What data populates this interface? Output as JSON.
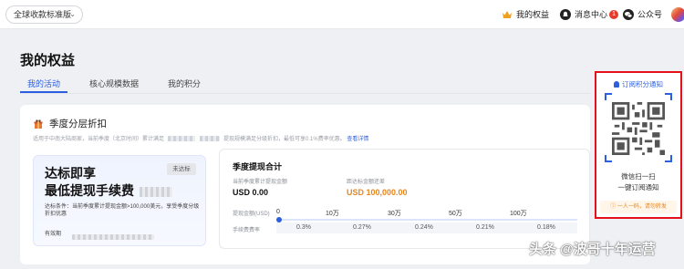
{
  "header": {
    "version_select": "全球收款标准版",
    "benefits": "我的权益",
    "messages": "消息中心",
    "message_count": "1",
    "official_account": "公众号"
  },
  "page": {
    "title": "我的权益",
    "tabs": [
      {
        "label": "我的活动",
        "active": true
      },
      {
        "label": "核心规模数据",
        "active": false
      },
      {
        "label": "我的积分",
        "active": false
      }
    ]
  },
  "activity": {
    "title": "季度分层折扣",
    "desc_start": "适用于中南大陆商家，当前季度（北京时间）累计满足",
    "desc_mid": "提现规模满足分级折扣，最低可享0.1%费率优惠。",
    "desc_link": "查看详情",
    "promo_line1": "达标即享",
    "promo_line2": "最低提现手续费",
    "status": "未达标",
    "condition": "达标条件：当前季度累计提现金额>100,000美元，享受季度分级折扣优惠",
    "valid_label": "有效期"
  },
  "summary": {
    "title": "季度提现合计",
    "current_label": "当前季度累计提现金额",
    "current_value": "USD 0.00",
    "gap_label": "距达标金额还差",
    "gap_value": "USD 100,000.00",
    "axis_label": "提现金额(USD)",
    "fee_label": "手续费费率",
    "ticks": [
      "0",
      "10万",
      "30万",
      "50万",
      "100万"
    ],
    "rates": [
      "0.3%",
      "0.27%",
      "0.24%",
      "0.21%",
      "0.18%"
    ]
  },
  "subscribe": {
    "title": "订阅积分通知",
    "line1": "微信扫一扫",
    "line2": "一键订阅通知",
    "hint": "一人一码，请勿转发"
  },
  "watermark": "头条 @波哥十年运营",
  "colors": {
    "accent": "#2c5fe0",
    "warning": "#e8861c",
    "highlight_border": "#e6101a",
    "badge": "#e53b2c"
  }
}
